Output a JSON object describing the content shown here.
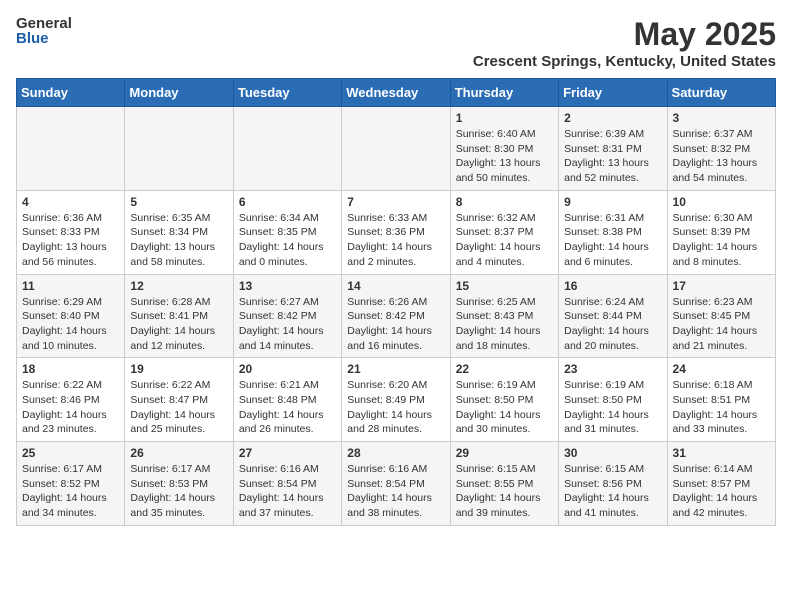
{
  "header": {
    "logo_general": "General",
    "logo_blue": "Blue",
    "main_title": "May 2025",
    "subtitle": "Crescent Springs, Kentucky, United States"
  },
  "days_of_week": [
    "Sunday",
    "Monday",
    "Tuesday",
    "Wednesday",
    "Thursday",
    "Friday",
    "Saturday"
  ],
  "weeks": [
    [
      {
        "day": "",
        "info": ""
      },
      {
        "day": "",
        "info": ""
      },
      {
        "day": "",
        "info": ""
      },
      {
        "day": "",
        "info": ""
      },
      {
        "day": "1",
        "info": "Sunrise: 6:40 AM\nSunset: 8:30 PM\nDaylight: 13 hours\nand 50 minutes."
      },
      {
        "day": "2",
        "info": "Sunrise: 6:39 AM\nSunset: 8:31 PM\nDaylight: 13 hours\nand 52 minutes."
      },
      {
        "day": "3",
        "info": "Sunrise: 6:37 AM\nSunset: 8:32 PM\nDaylight: 13 hours\nand 54 minutes."
      }
    ],
    [
      {
        "day": "4",
        "info": "Sunrise: 6:36 AM\nSunset: 8:33 PM\nDaylight: 13 hours\nand 56 minutes."
      },
      {
        "day": "5",
        "info": "Sunrise: 6:35 AM\nSunset: 8:34 PM\nDaylight: 13 hours\nand 58 minutes."
      },
      {
        "day": "6",
        "info": "Sunrise: 6:34 AM\nSunset: 8:35 PM\nDaylight: 14 hours\nand 0 minutes."
      },
      {
        "day": "7",
        "info": "Sunrise: 6:33 AM\nSunset: 8:36 PM\nDaylight: 14 hours\nand 2 minutes."
      },
      {
        "day": "8",
        "info": "Sunrise: 6:32 AM\nSunset: 8:37 PM\nDaylight: 14 hours\nand 4 minutes."
      },
      {
        "day": "9",
        "info": "Sunrise: 6:31 AM\nSunset: 8:38 PM\nDaylight: 14 hours\nand 6 minutes."
      },
      {
        "day": "10",
        "info": "Sunrise: 6:30 AM\nSunset: 8:39 PM\nDaylight: 14 hours\nand 8 minutes."
      }
    ],
    [
      {
        "day": "11",
        "info": "Sunrise: 6:29 AM\nSunset: 8:40 PM\nDaylight: 14 hours\nand 10 minutes."
      },
      {
        "day": "12",
        "info": "Sunrise: 6:28 AM\nSunset: 8:41 PM\nDaylight: 14 hours\nand 12 minutes."
      },
      {
        "day": "13",
        "info": "Sunrise: 6:27 AM\nSunset: 8:42 PM\nDaylight: 14 hours\nand 14 minutes."
      },
      {
        "day": "14",
        "info": "Sunrise: 6:26 AM\nSunset: 8:42 PM\nDaylight: 14 hours\nand 16 minutes."
      },
      {
        "day": "15",
        "info": "Sunrise: 6:25 AM\nSunset: 8:43 PM\nDaylight: 14 hours\nand 18 minutes."
      },
      {
        "day": "16",
        "info": "Sunrise: 6:24 AM\nSunset: 8:44 PM\nDaylight: 14 hours\nand 20 minutes."
      },
      {
        "day": "17",
        "info": "Sunrise: 6:23 AM\nSunset: 8:45 PM\nDaylight: 14 hours\nand 21 minutes."
      }
    ],
    [
      {
        "day": "18",
        "info": "Sunrise: 6:22 AM\nSunset: 8:46 PM\nDaylight: 14 hours\nand 23 minutes."
      },
      {
        "day": "19",
        "info": "Sunrise: 6:22 AM\nSunset: 8:47 PM\nDaylight: 14 hours\nand 25 minutes."
      },
      {
        "day": "20",
        "info": "Sunrise: 6:21 AM\nSunset: 8:48 PM\nDaylight: 14 hours\nand 26 minutes."
      },
      {
        "day": "21",
        "info": "Sunrise: 6:20 AM\nSunset: 8:49 PM\nDaylight: 14 hours\nand 28 minutes."
      },
      {
        "day": "22",
        "info": "Sunrise: 6:19 AM\nSunset: 8:50 PM\nDaylight: 14 hours\nand 30 minutes."
      },
      {
        "day": "23",
        "info": "Sunrise: 6:19 AM\nSunset: 8:50 PM\nDaylight: 14 hours\nand 31 minutes."
      },
      {
        "day": "24",
        "info": "Sunrise: 6:18 AM\nSunset: 8:51 PM\nDaylight: 14 hours\nand 33 minutes."
      }
    ],
    [
      {
        "day": "25",
        "info": "Sunrise: 6:17 AM\nSunset: 8:52 PM\nDaylight: 14 hours\nand 34 minutes."
      },
      {
        "day": "26",
        "info": "Sunrise: 6:17 AM\nSunset: 8:53 PM\nDaylight: 14 hours\nand 35 minutes."
      },
      {
        "day": "27",
        "info": "Sunrise: 6:16 AM\nSunset: 8:54 PM\nDaylight: 14 hours\nand 37 minutes."
      },
      {
        "day": "28",
        "info": "Sunrise: 6:16 AM\nSunset: 8:54 PM\nDaylight: 14 hours\nand 38 minutes."
      },
      {
        "day": "29",
        "info": "Sunrise: 6:15 AM\nSunset: 8:55 PM\nDaylight: 14 hours\nand 39 minutes."
      },
      {
        "day": "30",
        "info": "Sunrise: 6:15 AM\nSunset: 8:56 PM\nDaylight: 14 hours\nand 41 minutes."
      },
      {
        "day": "31",
        "info": "Sunrise: 6:14 AM\nSunset: 8:57 PM\nDaylight: 14 hours\nand 42 minutes."
      }
    ]
  ]
}
